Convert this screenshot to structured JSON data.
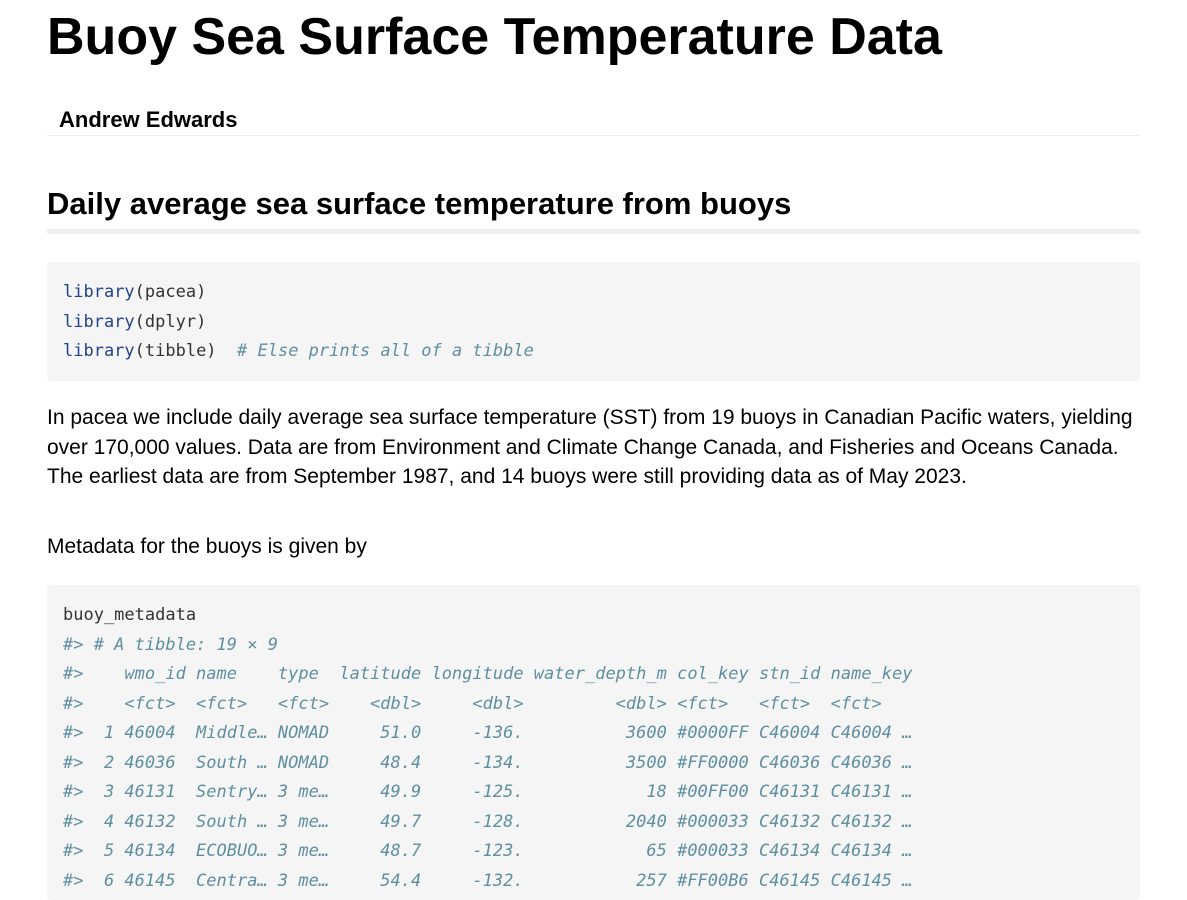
{
  "title": "Buoy Sea Surface Temperature Data",
  "author": "Andrew Edwards",
  "section_heading": "Daily average sea surface temperature from buoys",
  "code_block_1": [
    {
      "fn": "library",
      "arg": "(pacea)",
      "comment": ""
    },
    {
      "fn": "library",
      "arg": "(dplyr)",
      "comment": ""
    },
    {
      "fn": "library",
      "arg": "(tibble)",
      "comment": "# Else prints all of a tibble"
    }
  ],
  "paragraph_1": "In pacea we include daily average sea surface temperature (SST) from 19 buoys in Canadian Pacific waters, yielding over 170,000 values. Data are from Environment and Climate Change Canada, and Fisheries and Oceans Canada. The earliest data are from September 1987, and 14 buoys were still providing data as of May 2023.",
  "paragraph_2": "Metadata for the buoys is given by",
  "code_block_2": {
    "command": "buoy_metadata",
    "output_lines": [
      "#> # A tibble: 19 × 9",
      "#>    wmo_id name    type  latitude longitude water_depth_m col_key stn_id name_key",
      "#>    <fct>  <fct>   <fct>    <dbl>     <dbl>         <dbl> <fct>   <fct>  <fct>",
      "#>  1 46004  Middle… NOMAD     51.0     -136.          3600 #0000FF C46004 C46004 …",
      "#>  2 46036  South … NOMAD     48.4     -134.          3500 #FF0000 C46036 C46036 …",
      "#>  3 46131  Sentry… 3 me…     49.9     -125.            18 #00FF00 C46131 C46131 …",
      "#>  4 46132  South … 3 me…     49.7     -128.          2040 #000033 C46132 C46132 …",
      "#>  5 46134  ECOBUO… 3 me…     48.7     -123.            65 #000033 C46134 C46134 …",
      "#>  6 46145  Centra… 3 me…     54.4     -132.           257 #FF00B6 C46145 C46145 …"
    ]
  }
}
